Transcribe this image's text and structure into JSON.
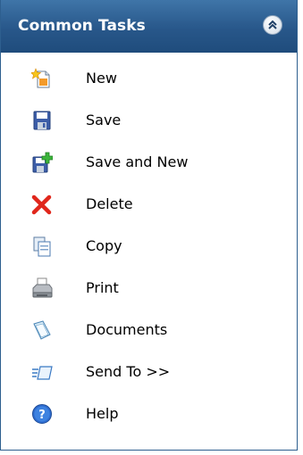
{
  "panel": {
    "title": "Common Tasks",
    "collapse_icon": "double-chevron-up-icon"
  },
  "items": [
    {
      "label": "New",
      "icon": "new-document-icon"
    },
    {
      "label": "Save",
      "icon": "floppy-disk-icon"
    },
    {
      "label": "Save and New",
      "icon": "save-and-new-icon"
    },
    {
      "label": "Delete",
      "icon": "red-x-icon"
    },
    {
      "label": "Copy",
      "icon": "copy-icon"
    },
    {
      "label": "Print",
      "icon": "printer-icon"
    },
    {
      "label": "Documents",
      "icon": "documents-icon"
    },
    {
      "label": "Send To >>",
      "icon": "send-to-icon"
    },
    {
      "label": "Help",
      "icon": "help-icon"
    }
  ],
  "colors": {
    "header_bg": "#28578a",
    "header_text": "#ffffff",
    "border": "#2e5f8f"
  }
}
